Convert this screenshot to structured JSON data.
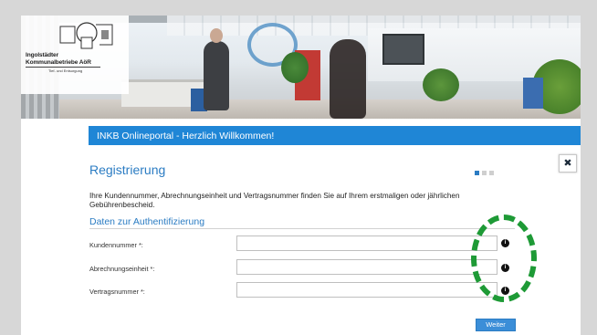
{
  "logo": {
    "line1": "Ingolstädter",
    "line2": "Kommunalbetriebe AöR",
    "line3": "Tief- und Entsorgung"
  },
  "portal": {
    "title": "INKB Onlineportal - Herzlich Willkommen!"
  },
  "dialog": {
    "title": "Registrierung",
    "close_symbol": "✖",
    "steps": {
      "total": 3,
      "current": 1
    },
    "info_text": "Ihre Kundennummer, Abrechnungseinheit und Vertragsnummer finden Sie auf Ihrem erstmaligen oder jährlichen Gebührenbescheid.",
    "section_title": "Daten zur Authentifizierung",
    "fields": [
      {
        "label": "Kundennummer *:",
        "value": "",
        "info_icon": "info-icon"
      },
      {
        "label": "Abrechnungseinheit *:",
        "value": "",
        "info_icon": "info-icon"
      },
      {
        "label": "Vertragsnummer *:",
        "value": "",
        "info_icon": "info-icon"
      }
    ],
    "next_button": "Weiter"
  },
  "colors": {
    "accent": "#1f86d6",
    "heading": "#2b7cc3",
    "step_active": "#2b7cc3",
    "step_inactive": "#cfcfcf",
    "annotation": "#1e9a36"
  }
}
